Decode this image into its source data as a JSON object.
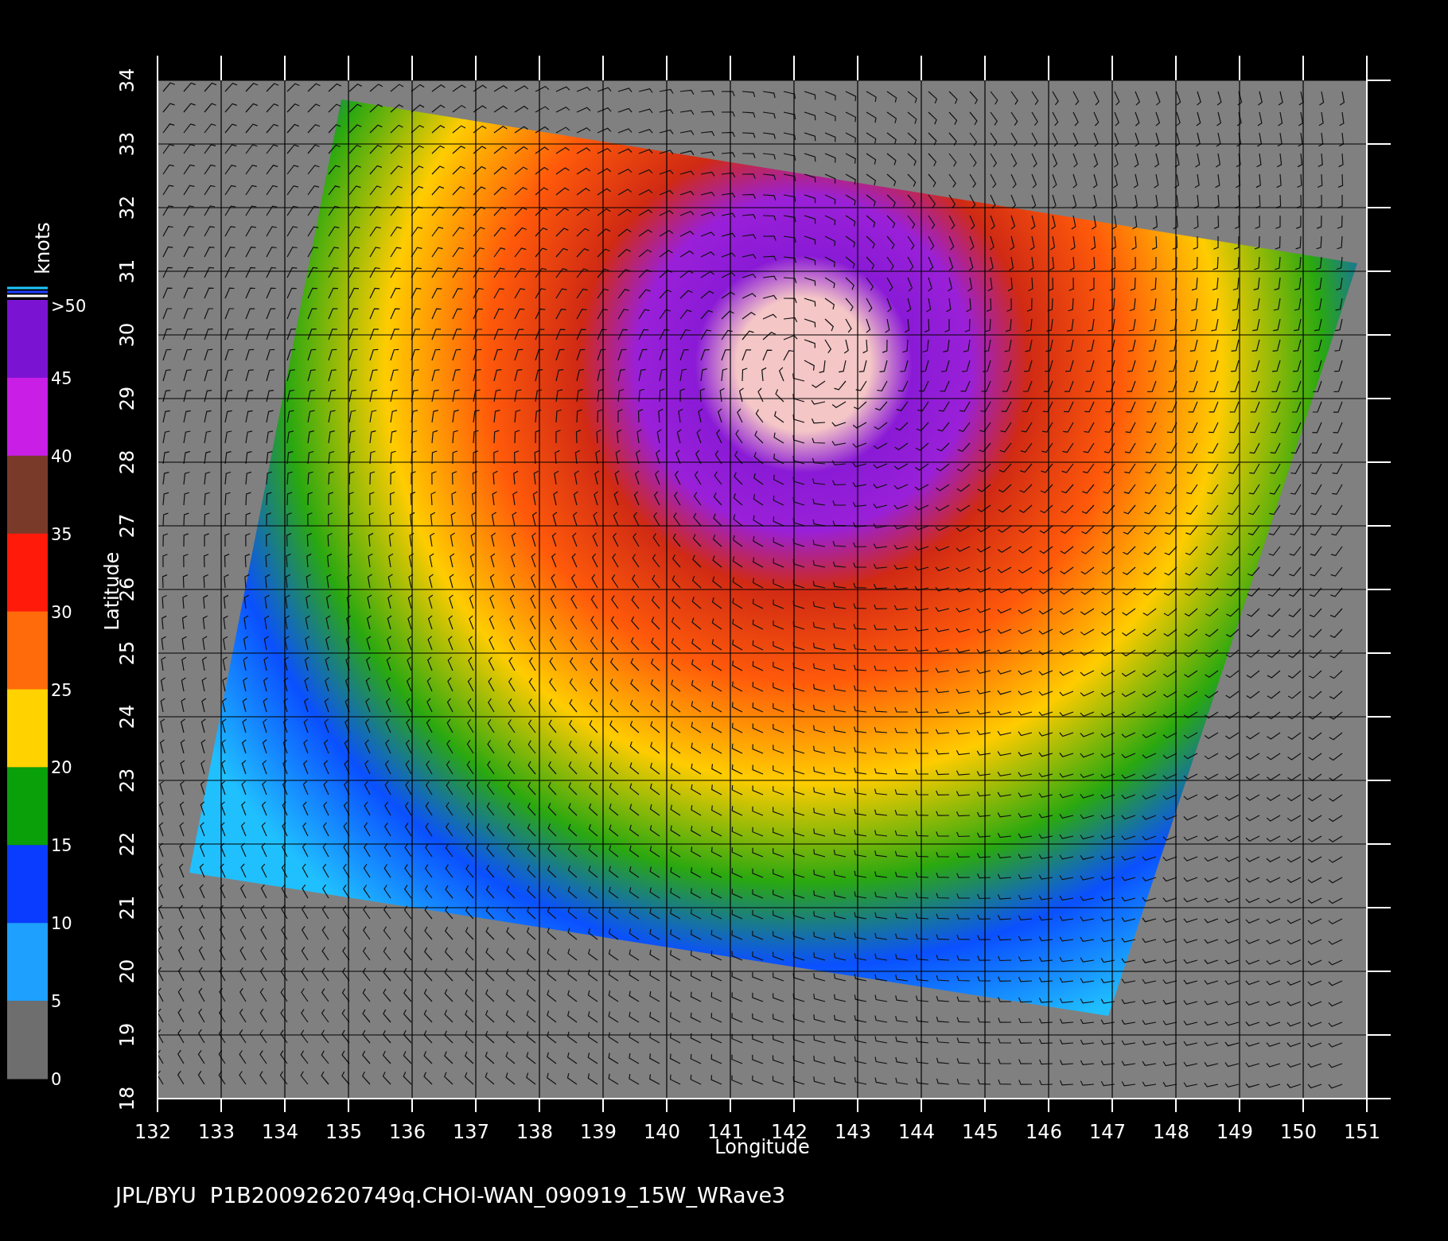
{
  "colorbar": {
    "unit": "knots",
    "segments": [
      {
        "color": "#7a14d2"
      },
      {
        "color": "#c81ee6"
      },
      {
        "color": "#7a3a2a"
      },
      {
        "color": "#ff1a0a"
      },
      {
        "color": "#ff6a0a"
      },
      {
        "color": "#ffd200"
      },
      {
        "color": "#0aa00a"
      },
      {
        "color": "#0a3cff"
      },
      {
        "color": "#1ea0ff"
      },
      {
        "color": "#6e6e6e"
      }
    ],
    "labels": [
      ">50",
      "45",
      "40",
      "35",
      "30",
      "25",
      "20",
      "15",
      "10",
      "5",
      "0"
    ]
  },
  "chart": {
    "xlabel": "Longitude",
    "ylabel": "Latitude",
    "xticks": [
      "132",
      "133",
      "134",
      "135",
      "136",
      "137",
      "138",
      "139",
      "140",
      "141",
      "142",
      "143",
      "144",
      "145",
      "146",
      "147",
      "148",
      "149",
      "150",
      "151"
    ],
    "yticks": [
      "18",
      "19",
      "20",
      "21",
      "22",
      "23",
      "24",
      "25",
      "26",
      "27",
      "28",
      "29",
      "30",
      "31",
      "32",
      "33",
      "34"
    ]
  },
  "caption": "JPL/BYU  P1B20092620749q.CHOI-WAN_090919_15W_WRave3"
}
